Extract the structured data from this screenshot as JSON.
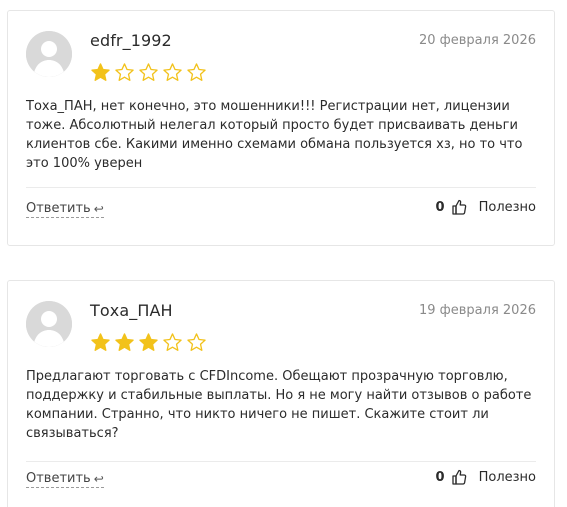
{
  "reviews": [
    {
      "author": "edfr_1992",
      "date": "20 февраля 2026",
      "rating": 1,
      "max_rating": 5,
      "text": "Тоха_ПАН, нет конечно, это мошенники!!! Регистрации нет, лицензии тоже. Абсолютный нелегал который просто будет присваивать деньги клиентов сбе. Какими именно схемами обмана пользуется хз, но то что это 100% уверен",
      "reply_label": "Ответить",
      "likes": "0",
      "helpful_label": "Полезно"
    },
    {
      "author": "Тоха_ПАН",
      "date": "19 февраля 2026",
      "rating": 3,
      "max_rating": 5,
      "text": "Предлагают торговать с CFDIncome. Обещают прозрачную торговлю, поддержку и стабильные выплаты. Но я не могу найти отзывов о работе компании. Странно, что никто ничего не пишет. Скажите стоит ли связываться?",
      "reply_label": "Ответить",
      "likes": "0",
      "helpful_label": "Полезно"
    }
  ],
  "colors": {
    "star_filled": "#f2c21b",
    "star_empty_stroke": "#f2c21b",
    "avatar_bg": "#d9d9d9",
    "avatar_fg": "#ffffff",
    "date": "#8a8a8a",
    "border": "#e6e6e6"
  },
  "icons": {
    "avatar": "user-silhouette-icon",
    "star": "star-icon",
    "reply": "reply-arrow-icon",
    "like": "thumbs-up-icon"
  }
}
